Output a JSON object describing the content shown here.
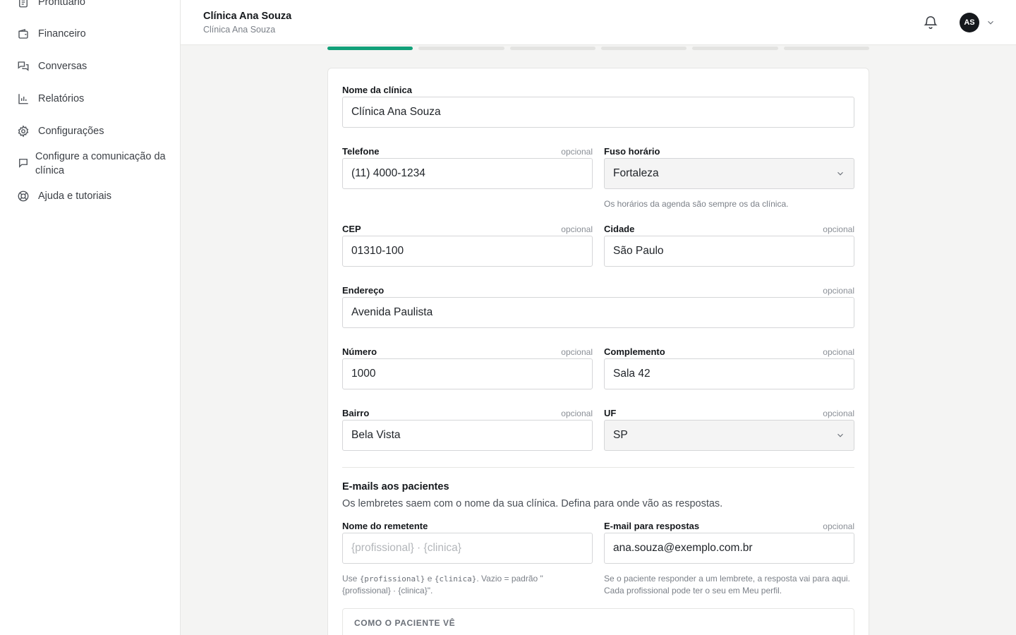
{
  "sidebar": {
    "items": [
      {
        "label": "Prontuário",
        "icon": "document-icon"
      },
      {
        "label": "Financeiro",
        "icon": "wallet-icon"
      },
      {
        "label": "Conversas",
        "icon": "chat-icon"
      },
      {
        "label": "Relatórios",
        "icon": "bar-chart-icon"
      },
      {
        "label": "Configurações",
        "icon": "gear-icon"
      },
      {
        "label": "Configure a comunicação da clínica",
        "icon": "message-square-icon"
      },
      {
        "label": "Ajuda e tutoriais",
        "icon": "lifebuoy-icon"
      }
    ]
  },
  "header": {
    "title": "Clínica Ana Souza",
    "subtitle": "Clínica Ana Souza",
    "avatar_initials": "AS"
  },
  "progress": {
    "total_steps": 6,
    "current_step": 1,
    "active_color": "#12a079"
  },
  "form": {
    "optional_label": "opcional",
    "clinic_name": {
      "label": "Nome da clínica",
      "value": "Clínica Ana Souza"
    },
    "phone": {
      "label": "Telefone",
      "value": "(11) 4000-1234"
    },
    "timezone": {
      "label": "Fuso horário",
      "value": "Fortaleza",
      "help": "Os horários da agenda são sempre os da clínica."
    },
    "cep": {
      "label": "CEP",
      "value": "01310-100"
    },
    "city": {
      "label": "Cidade",
      "value": "São Paulo"
    },
    "address": {
      "label": "Endereço",
      "value": "Avenida Paulista"
    },
    "number": {
      "label": "Número",
      "value": "1000"
    },
    "complement": {
      "label": "Complemento",
      "value": "Sala 42"
    },
    "district": {
      "label": "Bairro",
      "value": "Bela Vista"
    },
    "state": {
      "label": "UF",
      "value": "SP"
    }
  },
  "emails": {
    "title": "E-mails aos pacientes",
    "description": "Os lembretes saem com o nome da sua clínica. Defina para onde vão as respostas.",
    "sender_name": {
      "label": "Nome do remetente",
      "value": "",
      "placeholder": "{profissional} · {clinica}",
      "help_prefix": "Use ",
      "help_code1": "{profissional}",
      "help_mid": " e ",
      "help_code2": "{clinica}",
      "help_suffix": ". Vazio = padrão \"{profissional} · {clinica}\"."
    },
    "reply_email": {
      "label": "E-mail para respostas",
      "value": "ana.souza@exemplo.com.br",
      "help": "Se o paciente responder a um lembrete, a resposta vai para aqui. Cada profissional pode ter o seu em Meu perfil."
    },
    "preview_label": "COMO O PACIENTE VÊ"
  }
}
